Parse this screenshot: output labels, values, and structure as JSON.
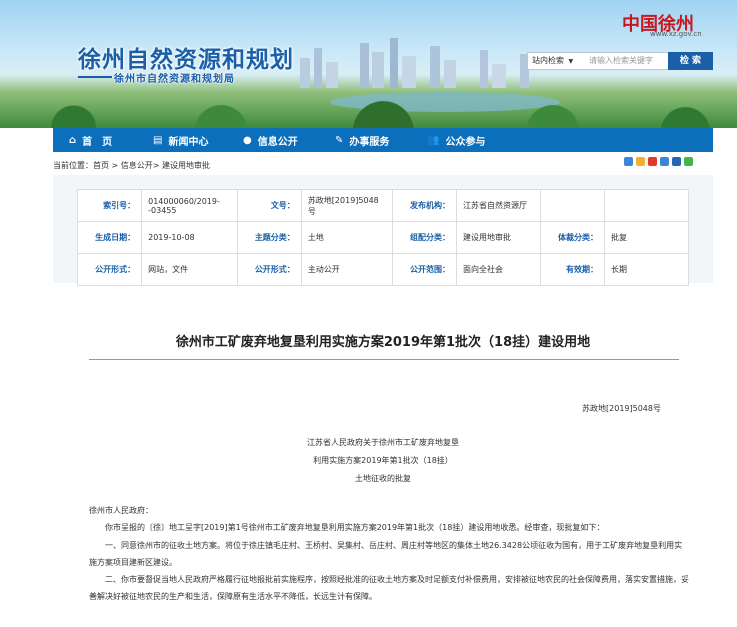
{
  "header": {
    "site_title": "徐州自然资源和规划",
    "site_subtitle": "徐州市自然资源和规划局",
    "brand_logo": "中国徐州",
    "brand_url": "www.xz.gov.cn",
    "search": {
      "scope": "站内检索",
      "placeholder": "请输入检索关键字",
      "button": "检 索"
    }
  },
  "nav": {
    "items": [
      {
        "label": "首　页",
        "icon": "home-icon"
      },
      {
        "label": "新闻中心",
        "icon": "news-icon"
      },
      {
        "label": "信息公开",
        "icon": "info-icon"
      },
      {
        "label": "办事服务",
        "icon": "service-icon"
      },
      {
        "label": "公众参与",
        "icon": "people-icon"
      }
    ]
  },
  "breadcrumb": "当前位置：首页 > 信息公开> 建设用地审批",
  "info": {
    "rows": [
      [
        {
          "label": "索引号：",
          "value": "014000060/2019--03455"
        },
        {
          "label": "文号：",
          "value": "苏政地[2019]5048号"
        },
        {
          "label": "发布机构：",
          "value": "江苏省自然资源厅"
        },
        {
          "label": "",
          "value": ""
        }
      ],
      [
        {
          "label": "生成日期：",
          "value": "2019-10-08"
        },
        {
          "label": "主题分类：",
          "value": "土地"
        },
        {
          "label": "组配分类：",
          "value": "建设用地审批"
        },
        {
          "label": "体裁分类：",
          "value": "批复"
        }
      ],
      [
        {
          "label": "公开形式：",
          "value": "网站，文件"
        },
        {
          "label": "公开形式：",
          "value": "主动公开"
        },
        {
          "label": "公开范围：",
          "value": "面向全社会"
        },
        {
          "label": "有效期：",
          "value": "长期"
        }
      ]
    ]
  },
  "article": {
    "title": "徐州市工矿废弃地复垦利用实施方案2019年第1批次（18挂）建设用地",
    "doc_no": "苏政地[2019]5048号",
    "heading_lines": [
      "江苏省人民政府关于徐州市工矿废弃地复垦",
      "利用实施方案2019年第1批次（18挂）",
      "土地征收的批复"
    ],
    "salutation": "徐州市人民政府：",
    "paragraphs": [
      "　　你市呈报的〔徐〕地工呈字[2019]第1号徐州市工矿废弃地复垦利用实施方案2019年第1批次（18挂）建设用地收悉。经审查，现批复如下：",
      "　　一、同意徐州市的征收土地方案。将位于徐庄镇毛庄村、王桥村、吴集村、岳庄村、周庄村等地区的集体土地26.3428公顷征收为国有，用于工矿废弃地复垦利用实施方案项目建新区建设。",
      "　　二、你市要督促当地人民政府严格履行征地报批前实施程序，按照经批准的征收土地方案及时足额支付补偿费用，安排被征地农民的社会保障费用，落实安置措施，妥善解决好被征地农民的生产和生活，保障原有生活水平不降低，长远生计有保障。"
    ]
  }
}
